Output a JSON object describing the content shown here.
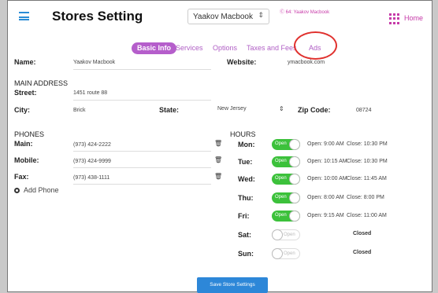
{
  "header": {
    "title": "Stores Setting",
    "store_select_value": "Yaakov Macbook",
    "store_link": "Ⓒ 64: Yaakov Macbook",
    "home_label": "Home"
  },
  "tabs": [
    {
      "label": "Basic Info",
      "active": true
    },
    {
      "label": "Services"
    },
    {
      "label": "Options"
    },
    {
      "label": "Taxes and Fees"
    },
    {
      "label": "Ads"
    }
  ],
  "basic": {
    "name_label": "Name:",
    "name_value": "Yaakov Macbook",
    "website_label": "Website:",
    "website_value": "ymacbook.com"
  },
  "address": {
    "heading": "MAIN ADDRESS",
    "street_label": "Street:",
    "street_value": "1451 route 88",
    "city_label": "City:",
    "city_value": "Brick",
    "state_label": "State:",
    "state_value": "New Jersey",
    "zip_label": "Zip Code:",
    "zip_value": "08724"
  },
  "phones": {
    "heading": "PHONES",
    "items": [
      {
        "label": "Main:",
        "value": "(973) 424-2222"
      },
      {
        "label": "Mobile:",
        "value": "(973) 424-9999"
      },
      {
        "label": "Fax:",
        "value": "(973) 438-1111"
      }
    ],
    "add_label": "Add Phone"
  },
  "hours": {
    "heading": "HOURS",
    "open_word": "Open",
    "closed_word": "Closed",
    "days": [
      {
        "day": "Mon:",
        "open": true,
        "open_time": "Open:  9:00 AM",
        "close_time": "Close:  10:30 PM"
      },
      {
        "day": "Tue:",
        "open": true,
        "open_time": "Open:  10:15 AM",
        "close_time": "Close:  10:30 PM"
      },
      {
        "day": "Wed:",
        "open": true,
        "open_time": "Open:  10:00 AM",
        "close_time": "Close:  11:45 AM"
      },
      {
        "day": "Thu:",
        "open": true,
        "open_time": "Open:  8:00 AM",
        "close_time": "Close:  8:00 PM"
      },
      {
        "day": "Fri:",
        "open": true,
        "open_time": "Open:  9:15 AM",
        "close_time": "Close:  11:00 AM"
      },
      {
        "day": "Sat:",
        "open": false,
        "status": "Closed"
      },
      {
        "day": "Sun:",
        "open": false,
        "status": "Closed"
      }
    ]
  },
  "save_label": "Save Store Settings",
  "colors": {
    "accent": "#b55ecb",
    "primary": "#2d87d8",
    "toggle_on": "#3cc13b",
    "highlight": "#e0312e"
  }
}
